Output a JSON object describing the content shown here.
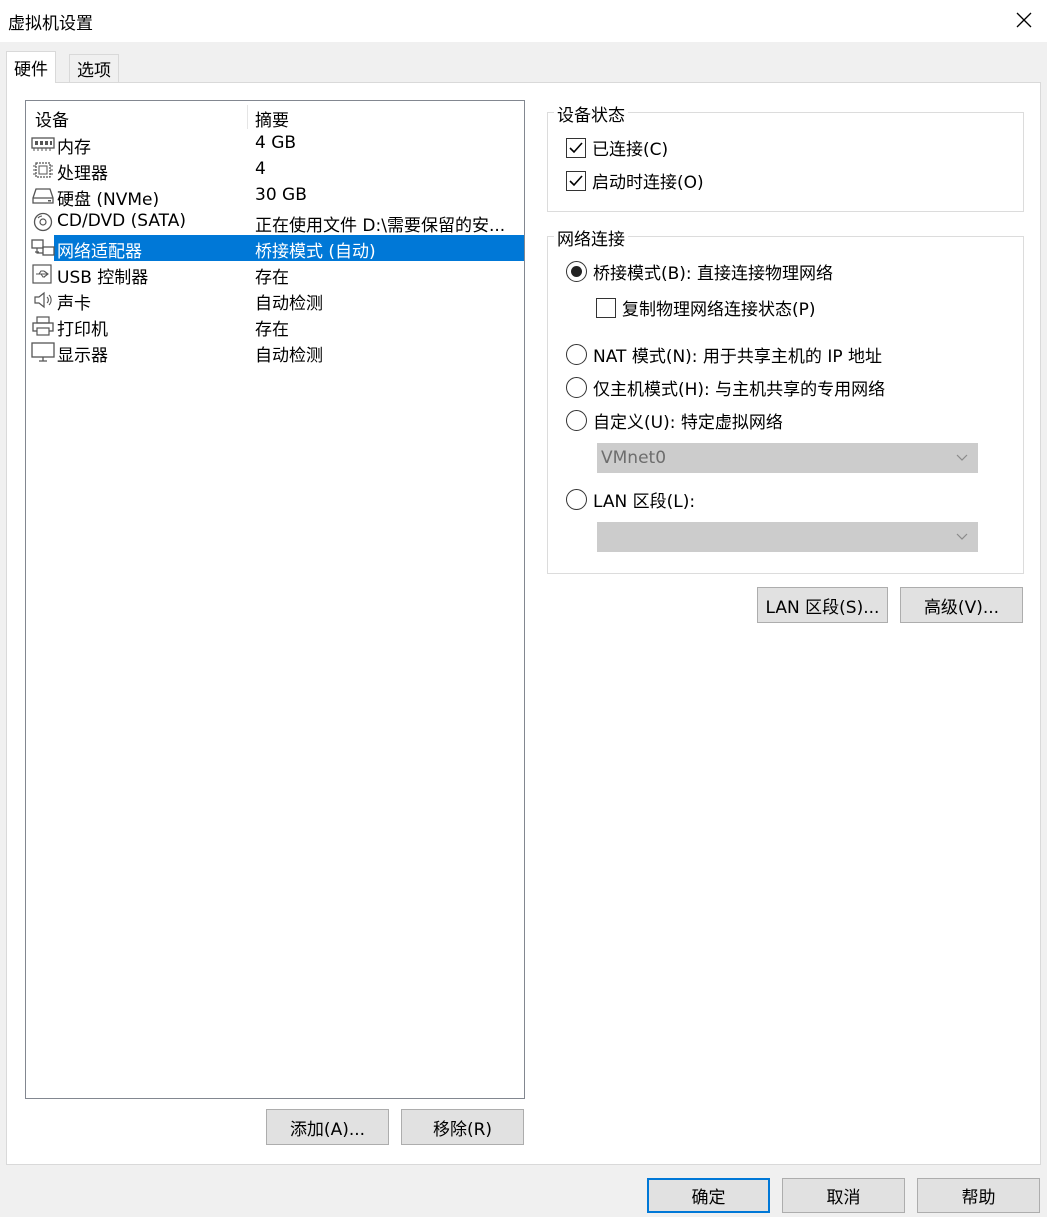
{
  "window": {
    "title": "虚拟机设置"
  },
  "tabs": [
    {
      "label": "硬件",
      "active": true
    },
    {
      "label": "选项",
      "active": false
    }
  ],
  "device_list": {
    "columns": [
      "设备",
      "摘要"
    ],
    "rows": [
      {
        "icon": "memory-icon",
        "name": "内存",
        "summary": "4 GB"
      },
      {
        "icon": "processor-icon",
        "name": "处理器",
        "summary": "4"
      },
      {
        "icon": "hard-disk-icon",
        "name": "硬盘 (NVMe)",
        "summary": "30 GB"
      },
      {
        "icon": "cd-dvd-icon",
        "name": "CD/DVD (SATA)",
        "summary": "正在使用文件 D:\\需要保留的安..."
      },
      {
        "icon": "network-adapter-icon",
        "name": "网络适配器",
        "summary": "桥接模式 (自动)",
        "selected": true
      },
      {
        "icon": "usb-icon",
        "name": "USB 控制器",
        "summary": "存在"
      },
      {
        "icon": "sound-card-icon",
        "name": "声卡",
        "summary": "自动检测"
      },
      {
        "icon": "printer-icon",
        "name": "打印机",
        "summary": "存在"
      },
      {
        "icon": "display-icon",
        "name": "显示器",
        "summary": "自动检测"
      }
    ]
  },
  "list_buttons": {
    "add": "添加(A)...",
    "remove": "移除(R)"
  },
  "device_status": {
    "title": "设备状态",
    "connected": {
      "label": "已连接(C)",
      "checked": true
    },
    "connect_at_power_on": {
      "label": "启动时连接(O)",
      "checked": true
    }
  },
  "network_connection": {
    "title": "网络连接",
    "bridged": {
      "label": "桥接模式(B): 直接连接物理网络",
      "selected": true
    },
    "replicate": {
      "label": "复制物理网络连接状态(P)",
      "checked": false
    },
    "nat": {
      "label": "NAT 模式(N): 用于共享主机的 IP 地址",
      "selected": false
    },
    "host_only": {
      "label": "仅主机模式(H): 与主机共享的专用网络",
      "selected": false
    },
    "custom": {
      "label": "自定义(U): 特定虚拟网络",
      "selected": false,
      "value": "VMnet0"
    },
    "lan_segment": {
      "label": "LAN 区段(L):",
      "selected": false,
      "value": ""
    }
  },
  "net_buttons": {
    "lan_segments": "LAN 区段(S)...",
    "advanced": "高级(V)..."
  },
  "footer_buttons": {
    "ok": "确定",
    "cancel": "取消",
    "help": "帮助"
  },
  "colors": {
    "selection": "#0078d7",
    "panel": "#ffffff",
    "background": "#f0f0f0"
  }
}
